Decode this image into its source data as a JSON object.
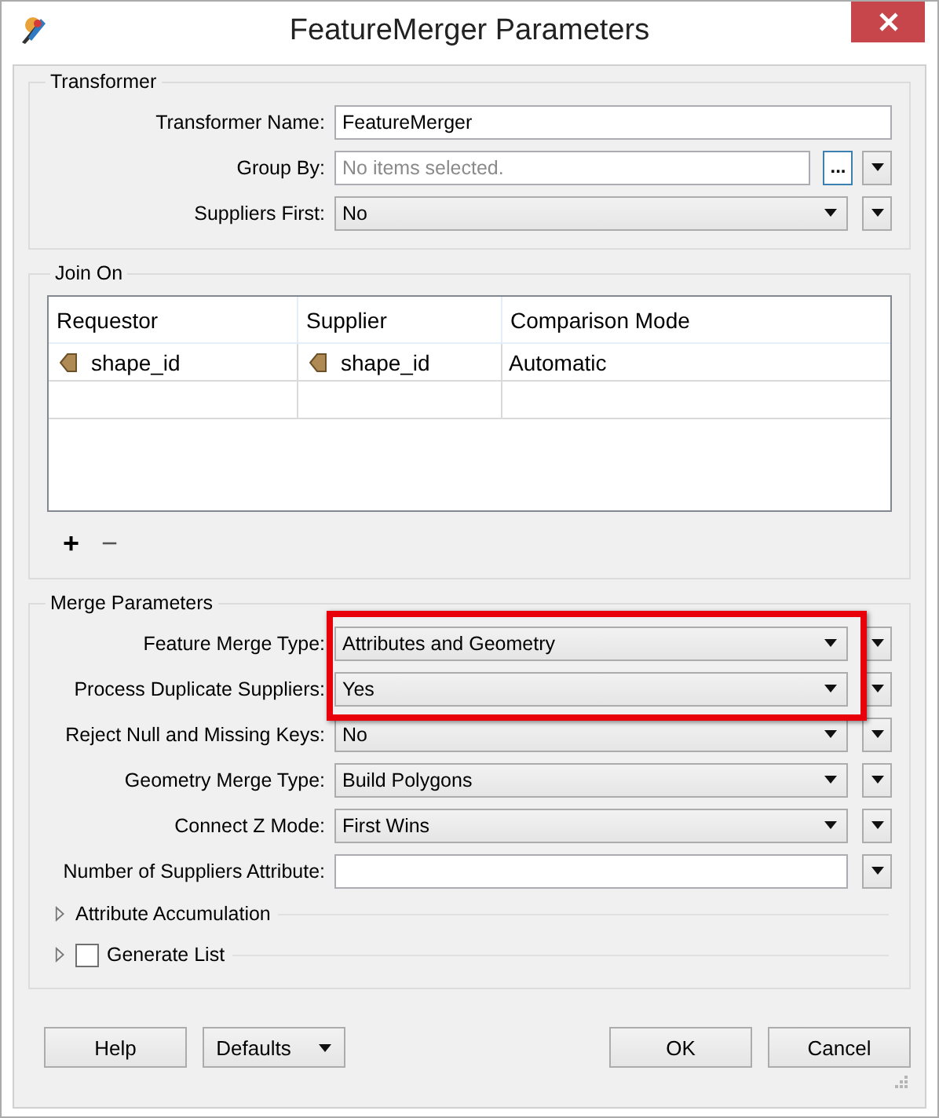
{
  "window": {
    "title": "FeatureMerger Parameters"
  },
  "transformer": {
    "title": "Transformer",
    "params": [
      {
        "kind": "text",
        "label": "Transformer Name:",
        "value": "FeatureMerger"
      },
      {
        "kind": "list",
        "label": "Group By:",
        "placeholder": "No items selected.",
        "browse": "..."
      },
      {
        "kind": "combo",
        "label": "Suppliers First:",
        "value": "No"
      }
    ]
  },
  "join_on": {
    "title": "Join On",
    "columns": [
      "Requestor",
      "Supplier",
      "Comparison Mode"
    ],
    "rows": [
      {
        "cells": [
          {
            "kind": "attribute",
            "text": "shape_id"
          },
          {
            "kind": "attribute",
            "text": "shape_id"
          },
          {
            "kind": "plain",
            "text": "Automatic"
          }
        ]
      }
    ],
    "add_button": "+",
    "remove_button": "−"
  },
  "merge_parameters": {
    "title": "Merge Parameters",
    "params": [
      {
        "kind": "combo",
        "label": "Feature Merge Type:",
        "value": "Attributes and Geometry",
        "highlighted": true
      },
      {
        "kind": "combo",
        "label": "Process Duplicate Suppliers:",
        "value": "Yes",
        "highlighted": true
      },
      {
        "kind": "combo",
        "label": "Reject Null and Missing Keys:",
        "value": "No",
        "highlighted": false
      },
      {
        "kind": "combo",
        "label": "Geometry Merge Type:",
        "value": "Build Polygons",
        "highlighted": false
      },
      {
        "kind": "combo",
        "label": "Connect Z Mode:",
        "value": "First Wins",
        "highlighted": false
      },
      {
        "kind": "text",
        "label": "Number of Suppliers Attribute:",
        "highlighted": false
      }
    ],
    "sections": [
      {
        "kind": "plain",
        "label": "Attribute Accumulation",
        "expanded": false
      },
      {
        "kind": "checkbox",
        "label": "Generate List",
        "expanded": false,
        "checked": false
      }
    ]
  },
  "buttons": {
    "help": "Help",
    "defaults": "Defaults",
    "ok": "OK",
    "cancel": "Cancel"
  }
}
